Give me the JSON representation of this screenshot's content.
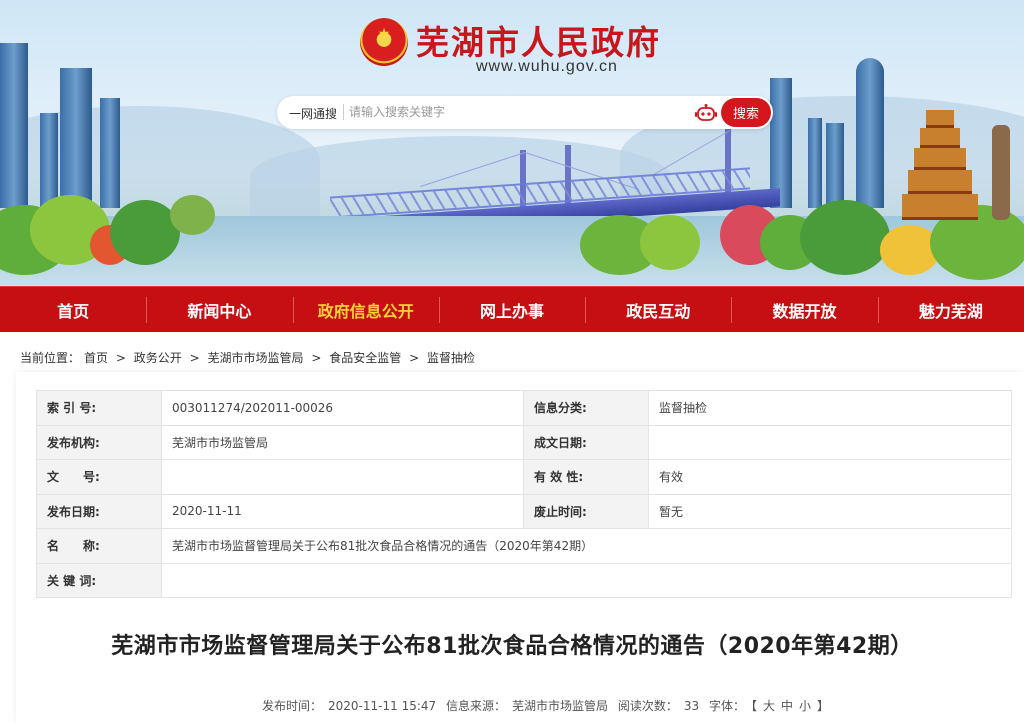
{
  "header": {
    "site_title": "芜湖市人民政府",
    "site_url": "www.wuhu.gov.cn"
  },
  "search": {
    "scope_label": "一网通搜",
    "placeholder": "请输入搜索关键字",
    "button_label": "搜索"
  },
  "nav": {
    "items": [
      {
        "label": "首页"
      },
      {
        "label": "新闻中心"
      },
      {
        "label": "政府信息公开"
      },
      {
        "label": "网上办事"
      },
      {
        "label": "政民互动"
      },
      {
        "label": "数据开放"
      },
      {
        "label": "魅力芜湖"
      }
    ],
    "active": "政府信息公开",
    "active_color": "#ffd23a"
  },
  "breadcrumb": {
    "prefix": "当前位置：",
    "separator": ">",
    "items": [
      "首页",
      "政务公开",
      "芜湖市市场监管局",
      "食品安全监管",
      "监督抽检"
    ]
  },
  "meta_table": {
    "rows": [
      {
        "k1": "索 引 号:",
        "v1": "003011274/202011-00026",
        "k2": "信息分类:",
        "v2": "监督抽检"
      },
      {
        "k1": "发布机构:",
        "v1": "芜湖市市场监管局",
        "k2": "成文日期:",
        "v2": ""
      },
      {
        "k1": "文　　号:",
        "v1": "",
        "k2": "有 效 性:",
        "v2": "有效"
      },
      {
        "k1": "发布日期:",
        "v1": "2020-11-11",
        "k2": "废止时间:",
        "v2": "暂无"
      }
    ],
    "name_label": "名　　称:",
    "name_value": "芜湖市市场监督管理局关于公布81批次食品合格情况的通告（2020年第42期）",
    "keywords_label": "关 键 词:",
    "keywords_value": ""
  },
  "document": {
    "title": "芜湖市市场监督管理局关于公布81批次食品合格情况的通告（2020年第42期）",
    "publish_time_label": "发布时间：",
    "publish_time": "2020-11-11 15:47",
    "source_label": "信息来源：",
    "source": "芜湖市市场监管局",
    "views_label": "阅读次数：",
    "views": "33",
    "font_label": "字体：",
    "font_open": "【",
    "font_large": "大",
    "font_medium": "中",
    "font_small": "小",
    "font_close": "】"
  },
  "colors": {
    "brand_red": "#c60f12",
    "title_red": "#c8161d"
  },
  "icons": [
    "national-emblem-icon",
    "robot-icon"
  ]
}
